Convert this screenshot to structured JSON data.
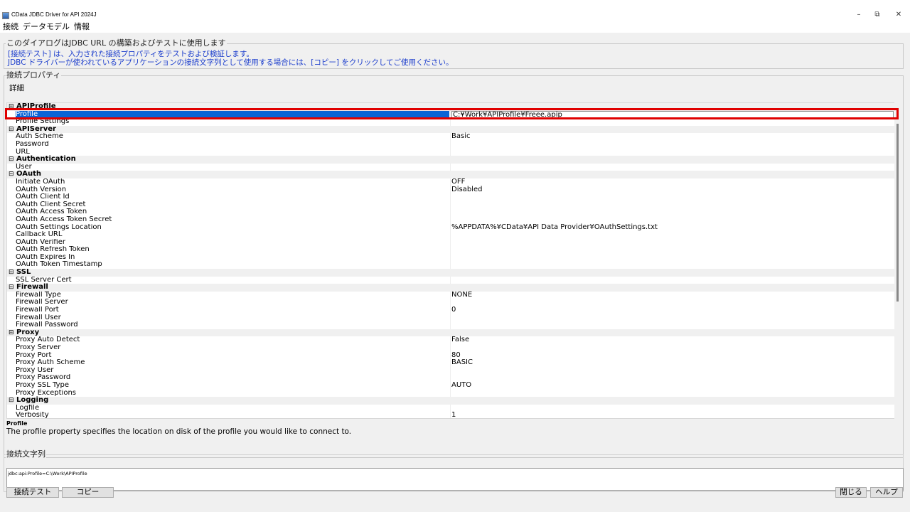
{
  "window": {
    "title": "CData JDBC Driver for API 2024J",
    "controls": {
      "minimize": "–",
      "restore": "⧉",
      "close": "✕"
    }
  },
  "menu": [
    "接続",
    "データモデル",
    "情報"
  ],
  "description": {
    "legend": "このダイアログはJDBC URL の構築およびテストに使用します",
    "line1": "[接続テスト] は、入力された接続プロパティをテストおよび検証します。",
    "line2": "JDBC ドライバーが使われているアプリケーションの接続文字列として使用する場合には、[コピー] をクリックしてご使用ください。"
  },
  "properties_group": {
    "legend": "接続プロパティ",
    "detail_label": "詳細",
    "rows": [
      {
        "type": "cat",
        "name": "APIProfile"
      },
      {
        "type": "prop",
        "name": "Profile",
        "value": "C:¥Work¥APIProfile¥Freee.apip",
        "selected": true
      },
      {
        "type": "prop",
        "name": "Profile Settings",
        "value": ""
      },
      {
        "type": "cat",
        "name": "APIServer"
      },
      {
        "type": "prop",
        "name": "Auth Scheme",
        "value": "Basic"
      },
      {
        "type": "prop",
        "name": "Password",
        "value": ""
      },
      {
        "type": "prop",
        "name": "URL",
        "value": ""
      },
      {
        "type": "cat",
        "name": "Authentication"
      },
      {
        "type": "prop",
        "name": "User",
        "value": ""
      },
      {
        "type": "cat",
        "name": "OAuth"
      },
      {
        "type": "prop",
        "name": "Initiate OAuth",
        "value": "OFF"
      },
      {
        "type": "prop",
        "name": "OAuth Version",
        "value": "Disabled"
      },
      {
        "type": "prop",
        "name": "OAuth Client Id",
        "value": ""
      },
      {
        "type": "prop",
        "name": "OAuth Client Secret",
        "value": ""
      },
      {
        "type": "prop",
        "name": "OAuth Access Token",
        "value": ""
      },
      {
        "type": "prop",
        "name": "OAuth Access Token Secret",
        "value": ""
      },
      {
        "type": "prop",
        "name": "OAuth Settings Location",
        "value": "%APPDATA%¥CData¥API Data Provider¥OAuthSettings.txt"
      },
      {
        "type": "prop",
        "name": "Callback URL",
        "value": ""
      },
      {
        "type": "prop",
        "name": "OAuth Verifier",
        "value": ""
      },
      {
        "type": "prop",
        "name": "OAuth Refresh Token",
        "value": ""
      },
      {
        "type": "prop",
        "name": "OAuth Expires In",
        "value": ""
      },
      {
        "type": "prop",
        "name": "OAuth Token Timestamp",
        "value": ""
      },
      {
        "type": "cat",
        "name": "SSL"
      },
      {
        "type": "prop",
        "name": "SSL Server Cert",
        "value": ""
      },
      {
        "type": "cat",
        "name": "Firewall"
      },
      {
        "type": "prop",
        "name": "Firewall Type",
        "value": "NONE"
      },
      {
        "type": "prop",
        "name": "Firewall Server",
        "value": ""
      },
      {
        "type": "prop",
        "name": "Firewall Port",
        "value": "0"
      },
      {
        "type": "prop",
        "name": "Firewall User",
        "value": ""
      },
      {
        "type": "prop",
        "name": "Firewall Password",
        "value": ""
      },
      {
        "type": "cat",
        "name": "Proxy"
      },
      {
        "type": "prop",
        "name": "Proxy Auto Detect",
        "value": "False"
      },
      {
        "type": "prop",
        "name": "Proxy Server",
        "value": ""
      },
      {
        "type": "prop",
        "name": "Proxy Port",
        "value": "80"
      },
      {
        "type": "prop",
        "name": "Proxy Auth Scheme",
        "value": "BASIC"
      },
      {
        "type": "prop",
        "name": "Proxy User",
        "value": ""
      },
      {
        "type": "prop",
        "name": "Proxy Password",
        "value": ""
      },
      {
        "type": "prop",
        "name": "Proxy SSL Type",
        "value": "AUTO"
      },
      {
        "type": "prop",
        "name": "Proxy Exceptions",
        "value": ""
      },
      {
        "type": "cat",
        "name": "Logging"
      },
      {
        "type": "prop",
        "name": "Logfile",
        "value": ""
      },
      {
        "type": "prop",
        "name": "Verbosity",
        "value": "1"
      }
    ]
  },
  "help": {
    "title": "Profile",
    "text": "The profile property specifies the location on disk of the profile you would like to connect to."
  },
  "connection_string": {
    "legend": "接続文字列",
    "value": "jdbc:api:Profile=C:\\Work\\APIProfile"
  },
  "buttons": {
    "test": "接続テスト",
    "copy": "コピー",
    "close": "閉じる",
    "help": "ヘルプ"
  },
  "colors": {
    "selection": "#0a64d6",
    "highlight_box": "#e00000",
    "info_text": "#1a3ccc"
  }
}
